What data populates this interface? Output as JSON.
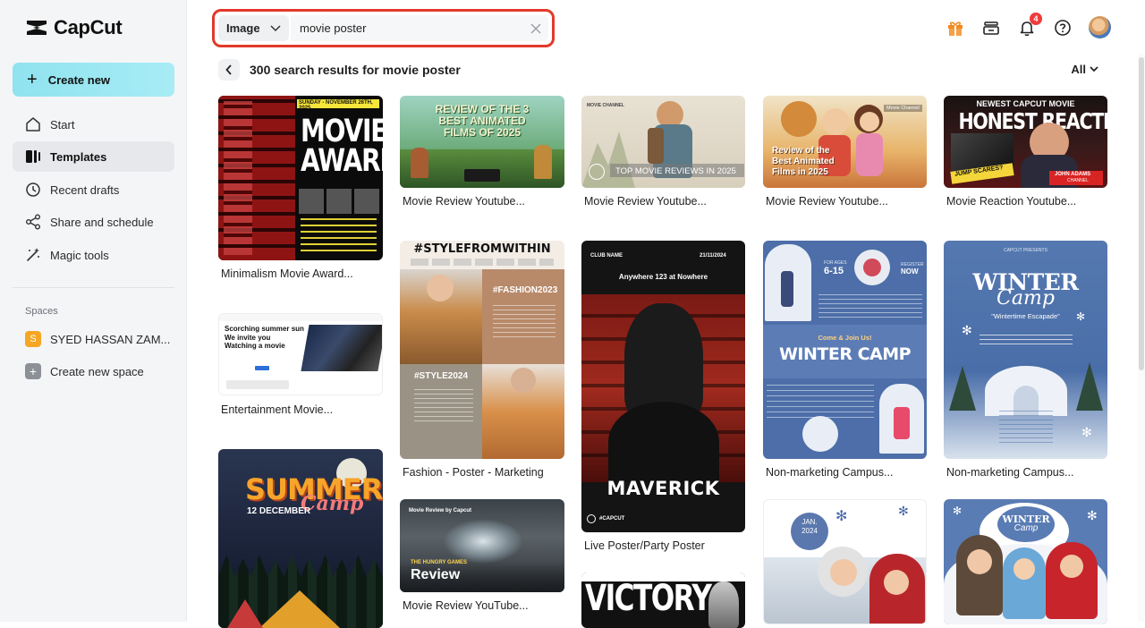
{
  "app": {
    "name": "CapCut"
  },
  "sidebar": {
    "create_label": "Create new",
    "nav": [
      {
        "label": "Start",
        "icon": "home-icon"
      },
      {
        "label": "Templates",
        "icon": "templates-icon"
      },
      {
        "label": "Recent drafts",
        "icon": "clock-icon"
      },
      {
        "label": "Share and schedule",
        "icon": "share-icon"
      },
      {
        "label": "Magic tools",
        "icon": "magic-wand-icon"
      }
    ],
    "spaces_label": "Spaces",
    "spaces": [
      {
        "badge": "S",
        "label": "SYED HASSAN ZAM..."
      },
      {
        "badge": "+",
        "label": "Create new space"
      }
    ]
  },
  "search": {
    "type": "Image",
    "query": "movie poster"
  },
  "notifications": {
    "count": "4"
  },
  "results": {
    "title": "300 search results for movie poster",
    "filter": "All"
  },
  "cards": [
    {
      "label": "Minimalism Movie Award...",
      "text": [
        "MOVIE",
        "AWARD"
      ],
      "caption": "SUNDAY - NOVEMBER 26TH, 2025"
    },
    {
      "label": "Entertainment Movie...",
      "text": [
        "Scorching summer sun",
        "We invite you",
        "Watching a movie"
      ]
    },
    {
      "label": "",
      "text": [
        "SUMMER",
        "Camp",
        "12 DECEMBER"
      ]
    },
    {
      "label": "Movie Review Youtube...",
      "text": [
        "REVIEW OF THE 3",
        "BEST ANIMATED",
        "FILMS OF 2025"
      ]
    },
    {
      "label": "Fashion - Poster - Marketing",
      "text": [
        "#STYLEFROMWITHIN",
        "#FASHION2023",
        "#STYLE2024"
      ]
    },
    {
      "label": "Movie Review YouTube...",
      "text": [
        "Review",
        "THE HUNGRY GAMES"
      ]
    },
    {
      "label": "Movie Review Youtube...",
      "text": [
        "TOP MOVIE REVIEWS IN 2025",
        "MOVIE CHANNEL"
      ]
    },
    {
      "label": "Live Poster/Party Poster",
      "text": [
        "MAVERICK",
        "Anywhere 123 at Nowhere",
        "CLUB NAME",
        "21/11/2024",
        "#CAPCUT"
      ]
    },
    {
      "label": "",
      "text": [
        "VICTORY"
      ]
    },
    {
      "label": "Movie Review Youtube...",
      "text": [
        "Review of the",
        "Best Animated",
        "Films in 2025",
        "Movie Channel"
      ]
    },
    {
      "label": "Non-marketing Campus...",
      "text": [
        "WINTER CAMP",
        "Come & Join Us!",
        "FOR AGES",
        "6-15",
        "REGISTER",
        "NOW"
      ]
    },
    {
      "label": "",
      "text": [
        "JAN.",
        "2024"
      ]
    },
    {
      "label": "Movie Reaction Youtube...",
      "text": [
        "NEWEST CAPCUT MOVIE",
        "HONEST REACTION",
        "JUMP SCARES?",
        "JOHN ADAMS",
        "CHANNEL"
      ]
    },
    {
      "label": "Non-marketing Campus...",
      "text": [
        "WINTER",
        "Camp",
        "\"Wintertime Escapade\"",
        "CAPCUT PRESENTS"
      ]
    },
    {
      "label": "",
      "text": [
        "WINTER",
        "Camp"
      ]
    }
  ],
  "colors": {
    "accent": "#e3392a",
    "create_button": "#a8ecf5",
    "sidebar_bg": "#f4f5f7"
  }
}
